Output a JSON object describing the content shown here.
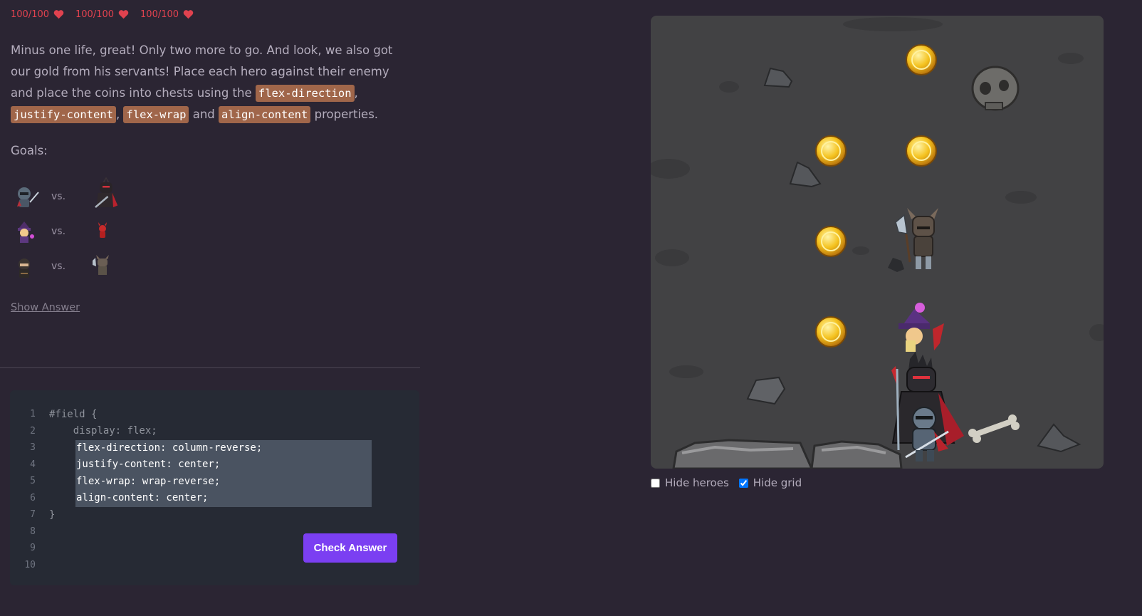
{
  "lives": [
    {
      "label": "100/100"
    },
    {
      "label": "100/100"
    },
    {
      "label": "100/100"
    }
  ],
  "colors": {
    "background": "#2b2533",
    "accent": "#7b3ff2",
    "keyword_bg": "#a0664a",
    "heart": "#e0424f",
    "field": "#424244"
  },
  "instructions": {
    "part1": "Minus one life, great! Only two more to go. And look, we also got our gold from his servants! Place each hero against their enemy and place the coins into chests using the ",
    "kw1": "flex-direction",
    "sep1": ", ",
    "kw2": "justify-content",
    "sep2": ", ",
    "kw3": "flex-wrap",
    "sep3": " and ",
    "kw4": "align-content",
    "part2": " properties."
  },
  "goals": {
    "title": "Goals:",
    "rows": [
      {
        "vs": "vs.",
        "hero_icon": "knight-hero-icon",
        "enemy_icon": "dark-lord-enemy-icon"
      },
      {
        "vs": "vs.",
        "hero_icon": "wizard-hero-icon",
        "enemy_icon": "imp-enemy-icon"
      },
      {
        "vs": "vs.",
        "hero_icon": "rogue-hero-icon",
        "enemy_icon": "axe-knight-enemy-icon"
      }
    ]
  },
  "show_answer": "Show Answer",
  "editor": {
    "lines": [
      {
        "num": "1",
        "text": "#field {"
      },
      {
        "num": "2",
        "text": "    display: flex;"
      },
      {
        "num": "3",
        "text": ""
      },
      {
        "num": "4",
        "text": ""
      },
      {
        "num": "5",
        "text": ""
      },
      {
        "num": "6",
        "text": ""
      },
      {
        "num": "7",
        "text": "}"
      },
      {
        "num": "8",
        "text": ""
      },
      {
        "num": "9",
        "text": ""
      },
      {
        "num": "10",
        "text": ""
      }
    ],
    "input_lines": [
      "flex-direction: column-reverse;",
      "justify-content: center;",
      "flex-wrap: wrap-reverse;",
      "align-content: center;"
    ],
    "check_button": "Check Answer"
  },
  "field": {
    "coins": 5,
    "sprites": [
      "coin-icon",
      "skull-icon",
      "rock-icon",
      "bone-icon",
      "axe-knight-icon",
      "wizard-icon",
      "dark-lord-icon",
      "knight-icon"
    ]
  },
  "toggles": {
    "hide_heroes": {
      "label": "Hide heroes",
      "checked": false
    },
    "hide_grid": {
      "label": "Hide grid",
      "checked": true
    }
  }
}
